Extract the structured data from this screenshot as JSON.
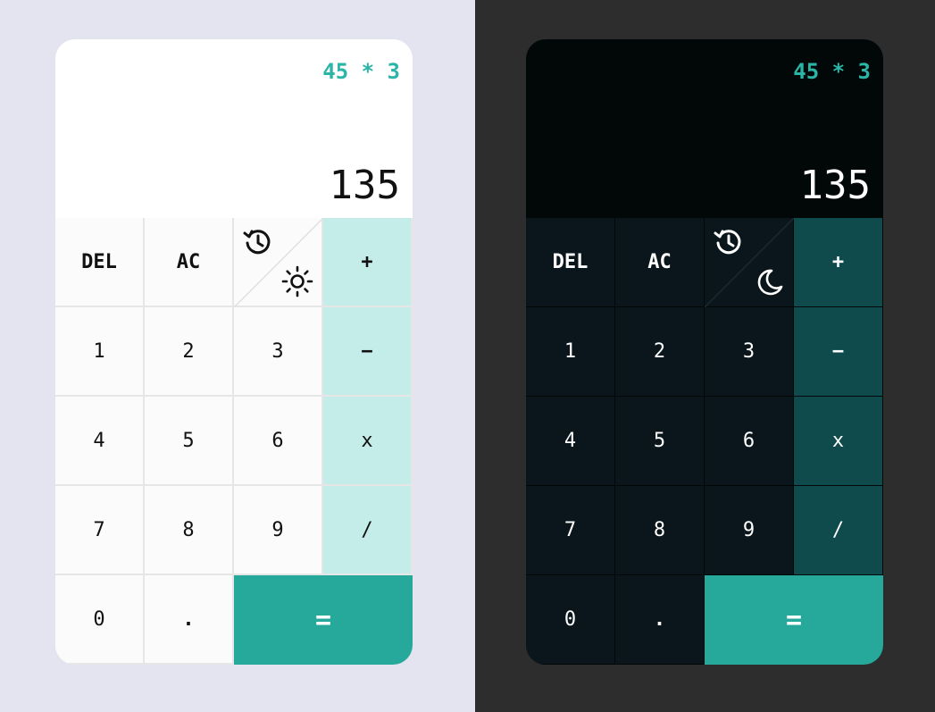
{
  "light": {
    "expression": "45 * 3",
    "result": "135",
    "mode_icon": "sun-icon"
  },
  "dark": {
    "expression": "45 * 3",
    "result": "135",
    "mode_icon": "moon-icon"
  },
  "keys": {
    "del": "DEL",
    "ac": "AC",
    "plus": "+",
    "minus": "−",
    "multiply": "x",
    "divide": "/",
    "one": "1",
    "two": "2",
    "three": "3",
    "four": "4",
    "five": "5",
    "six": "6",
    "seven": "7",
    "eight": "8",
    "nine": "9",
    "zero": "0",
    "dot": ".",
    "equals": "="
  },
  "colors": {
    "accent": "#26a89b",
    "expression": "#2bb5a6",
    "light_bg": "#e4e4f0",
    "light_operator": "#c4ece8",
    "dark_bg": "#2d2d2d",
    "dark_operator": "#0f4a4d",
    "dark_key": "#0a161b"
  }
}
